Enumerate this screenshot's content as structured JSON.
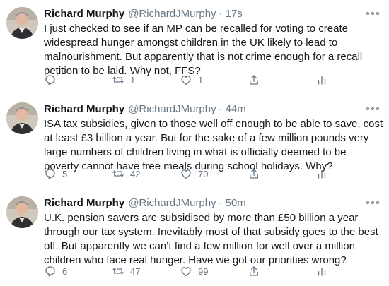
{
  "colors": {
    "text": "#14171a",
    "secondary": "#657786",
    "divider": "#e6ecf0"
  },
  "tweets": [
    {
      "name": "Richard Murphy",
      "handle": "@RichardJMurphy",
      "separator": "·",
      "time": "17s",
      "text": "I just checked to see if an MP can be recalled for voting to create widespread hunger amongst children in the UK likely to lead to malnourishment. But apparently that is not crime enough for a recall petition to be laid. Why not, FFS?",
      "replies": "",
      "retweets": "1",
      "likes": "1"
    },
    {
      "name": "Richard Murphy",
      "handle": "@RichardJMurphy",
      "separator": "·",
      "time": "44m",
      "text": "ISA tax subsidies, given to those well off enough to be able to save, cost at least £3 billion a year. But for the sake of a few million pounds very large numbers of children living in what is officially deemed to be poverty cannot have free meals during school holidays. Why?",
      "replies": "5",
      "retweets": "42",
      "likes": "70"
    },
    {
      "name": "Richard Murphy",
      "handle": "@RichardJMurphy",
      "separator": "·",
      "time": "50m",
      "text": "U.K. pension savers are subsidised by more than £50 billion a year through our tax system. Inevitably most of that subsidy goes to the best off. But apparently we can’t find a few million for well over a million children who face real hunger. Have we got our priorities wrong?",
      "replies": "6",
      "retweets": "47",
      "likes": "99"
    }
  ],
  "icons": {
    "reply": "reply-icon",
    "retweet": "retweet-icon",
    "like": "heart-icon",
    "share": "share-icon",
    "stats": "analytics-icon",
    "more": "more-options-icon"
  }
}
